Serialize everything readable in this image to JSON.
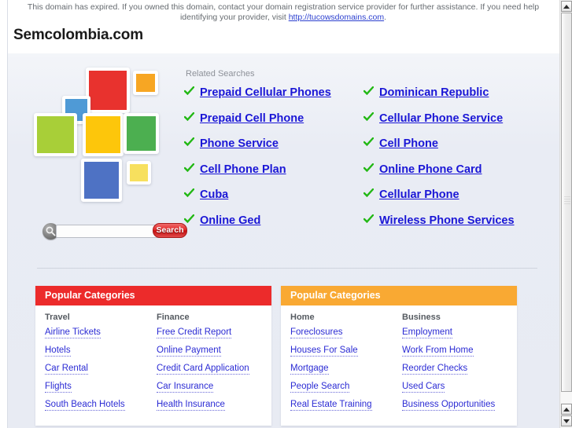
{
  "banner": {
    "text_before": "This domain has expired. If you owned this domain, contact your domain registration service provider for further assistance. If you need help identifying your provider, visit ",
    "link_text": "http://tucowsdomains.com",
    "text_after": "."
  },
  "header": {
    "domain": "Semcolombia.com"
  },
  "tiles": {
    "title": "colored-squares-graphic",
    "colors": [
      "#e8322e",
      "#f7a623",
      "#4f9ad6",
      "#a8cf38",
      "#fdc60b",
      "#4caf50",
      "#4e72c4",
      "#f7e05e"
    ]
  },
  "related": {
    "title": "Related Searches",
    "column_left": [
      "Prepaid Cellular Phones",
      "Prepaid Cell Phone",
      "Phone Service",
      "Cell Phone Plan",
      "Cuba",
      "Online Ged"
    ],
    "column_right": [
      "Dominican Republic",
      "Cellular Phone Service",
      "Cell Phone",
      "Online Phone Card",
      "Cellular Phone",
      "Wireless Phone Services"
    ]
  },
  "search": {
    "value": "",
    "placeholder": "",
    "button_label": "Search",
    "icon": "magnifier-icon"
  },
  "categories": [
    {
      "title": "Popular Categories",
      "accent": "#ec2b2b",
      "columns": [
        {
          "heading": "Travel",
          "links": [
            "Airline Tickets",
            "Hotels",
            "Car Rental",
            "Flights",
            "South Beach Hotels"
          ]
        },
        {
          "heading": "Finance",
          "links": [
            "Free Credit Report",
            "Online Payment",
            "Credit Card Application",
            "Car Insurance",
            "Health Insurance"
          ]
        }
      ]
    },
    {
      "title": "Popular Categories",
      "accent": "#f9a933",
      "columns": [
        {
          "heading": "Home",
          "links": [
            "Foreclosures",
            "Houses For Sale",
            "Mortgage",
            "People Search",
            "Real Estate Training"
          ]
        },
        {
          "heading": "Business",
          "links": [
            "Employment",
            "Work From Home",
            "Reorder Checks",
            "Used Cars",
            "Business Opportunities"
          ]
        }
      ]
    }
  ],
  "scrollbar": {
    "up_icon": "triangle-up-icon",
    "down_icon": "triangle-down-icon"
  }
}
